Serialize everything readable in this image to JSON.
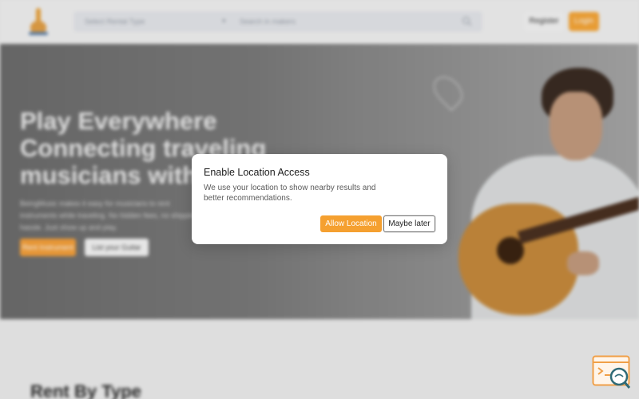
{
  "header": {
    "type_select": "Select Rental Type",
    "search_placeholder": "Search in makers",
    "register_label": "Register",
    "login_label": "Login"
  },
  "hero": {
    "headline": "Play Everywhere Connecting traveling musicians with",
    "subtext": "BeingMusic makes it easy for musicians to rent instruments while traveling. No hidden fees, no shipping hassle. Just show up and play.",
    "primary_button": "Rent Instrument",
    "secondary_button": "List your Guitar"
  },
  "section": {
    "heading": "Rent By Type"
  },
  "modal": {
    "title": "Enable Location Access",
    "description": "We use your location to show nearby results and better recommendations.",
    "allow_label": "Allow Location",
    "later_label": "Maybe later"
  },
  "colors": {
    "accent": "#f5a030",
    "overlay": "#000000"
  },
  "icons": {
    "logo": "guitar-logo-icon",
    "search": "search-icon",
    "chevron": "chevron-down-icon",
    "location": "location-pin-icon",
    "widget": "code-search-icon"
  }
}
